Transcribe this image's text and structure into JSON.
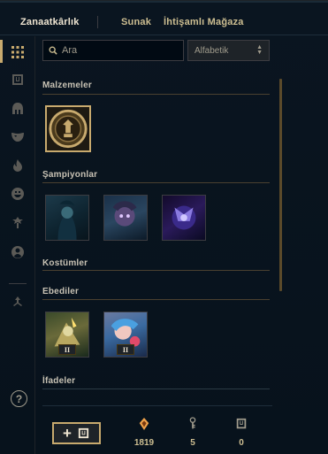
{
  "tabs": [
    {
      "label": "Zanaatkârlık",
      "active": true
    },
    {
      "label": "Sunak",
      "active": false
    },
    {
      "label": "İhtişamlı Mağaza",
      "active": false
    }
  ],
  "sidebar": {
    "items": [
      {
        "icon": "grid-icon",
        "active": true
      },
      {
        "icon": "chest-icon",
        "active": false
      },
      {
        "icon": "helmet-icon",
        "active": false
      },
      {
        "icon": "mask-icon",
        "active": false
      },
      {
        "icon": "flame-icon",
        "active": false
      },
      {
        "icon": "emote-face-icon",
        "active": false
      },
      {
        "icon": "ward-icon",
        "active": false
      },
      {
        "icon": "profile-icon",
        "active": false
      },
      {
        "icon": "crafting-arrows-icon",
        "active": false
      }
    ],
    "help_label": "?"
  },
  "search": {
    "placeholder": "Ara",
    "value": ""
  },
  "sort": {
    "selected": "Alfabetik"
  },
  "sections": [
    {
      "title": "Malzemeler",
      "items": [
        {
          "name": "hextech-key-fragment-medallion"
        }
      ]
    },
    {
      "title": "Şampiyonlar",
      "items": [
        {
          "name": "champion-1"
        },
        {
          "name": "champion-2"
        },
        {
          "name": "champion-3"
        }
      ]
    },
    {
      "title": "Kostümler",
      "items": []
    },
    {
      "title": "Ebediler",
      "items": [
        {
          "name": "eternal-1",
          "badge": "II"
        },
        {
          "name": "eternal-2",
          "badge": "II"
        }
      ]
    },
    {
      "title": "İfadeler",
      "items": []
    }
  ],
  "footer": {
    "add_button": "+",
    "currencies": [
      {
        "icon": "orange-essence-icon",
        "value": "1819",
        "color": "#f0a24a"
      },
      {
        "icon": "key-icon",
        "value": "5",
        "color": "#a09b8c"
      },
      {
        "icon": "chest-icon",
        "value": "0",
        "color": "#a09b8c"
      }
    ]
  },
  "colors": {
    "gold": "#c8aa6e",
    "background": "#010a13",
    "text": "#a09b8c"
  }
}
